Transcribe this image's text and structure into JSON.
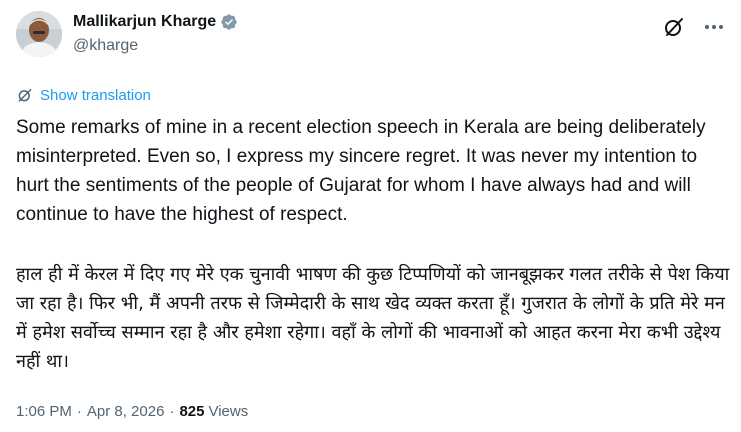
{
  "author": {
    "display_name": "Mallikarjun Kharge",
    "handle": "@kharge",
    "verified_color": "#829aab"
  },
  "actions": {
    "grok_icon": "grok-slash-icon",
    "more_icon": "more-horizontal-icon"
  },
  "translation": {
    "label": "Show translation",
    "icon": "translate-icon"
  },
  "tweet": {
    "text_en": "Some remarks of mine in a recent election speech in Kerala are being deliberately misinterpreted. Even so, I express my sincere regret. It was never my intention to hurt the sentiments of the people of Gujarat for whom I have always had and will continue to have the highest of respect.",
    "text_hi": "हाल ही में केरल में दिए गए मेरे एक चुनावी भाषण की कुछ टिप्पणियों को जानबूझकर गलत तरीके से पेश किया जा रहा है। फिर भी, मैं अपनी तरफ से जिम्मेदारी के साथ  खेद व्यक्त करता हूँ। गुजरात के लोगों के प्रति मेरे मन में हमेश सर्वोच्च सम्मान रहा है और हमेशा रहेगा। वहाँ के लोगों की भावनाओं को आहत करना मेरा कभी उद्देश्य नहीं था।"
  },
  "meta": {
    "time": "1:06 PM",
    "separator": "·",
    "date": "Apr 8, 2026",
    "views_count": "825",
    "views_label": "Views"
  },
  "colors": {
    "link": "#1d9bf0",
    "secondary_text": "#536471",
    "primary_text": "#0f1419"
  }
}
